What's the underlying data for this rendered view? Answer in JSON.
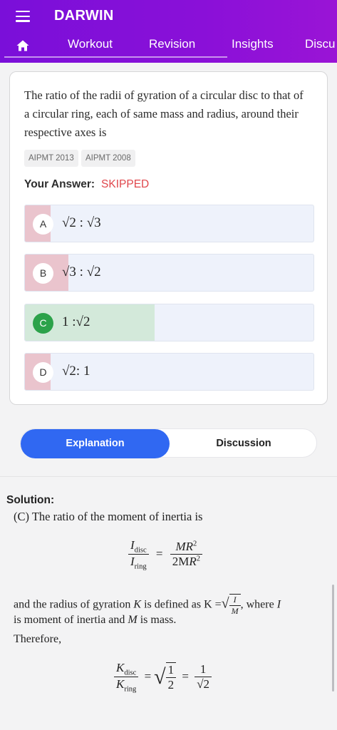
{
  "app": {
    "title": "DARWIN"
  },
  "tabs": [
    {
      "label": "Workout"
    },
    {
      "label": "Revision"
    },
    {
      "label": "Insights"
    },
    {
      "label": "Discu"
    }
  ],
  "question": {
    "text": "The ratio of the radii of gyration of a circular disc to that of a circular ring, each of same mass and radius, around their respective axes is",
    "tags": [
      "AIPMT 2013",
      "AIPMT 2008"
    ],
    "answer_label": "Your Answer:",
    "answer_value": "SKIPPED"
  },
  "options": [
    {
      "letter": "A",
      "text": "√2 : √3",
      "fill_fraction": 0.09,
      "fill_color": "#eac4cd"
    },
    {
      "letter": "B",
      "text": "√3 : √2",
      "fill_fraction": 0.15,
      "fill_color": "#eac4cd"
    },
    {
      "letter": "C",
      "text": "1 :√2",
      "fill_fraction": 0.45,
      "fill_color": "#d3e9da",
      "correct": true
    },
    {
      "letter": "D",
      "text": "√2: 1",
      "fill_fraction": 0.09,
      "fill_color": "#eac4cd"
    }
  ],
  "segments": {
    "active": "Explanation",
    "other": "Discussion"
  },
  "solution": {
    "title": "Solution:",
    "line1": "(C) The ratio of the moment of inertia is",
    "line2a": "and the radius of gyration",
    "line2b": "is defined as",
    "line2c": ", where",
    "line3": "is moment of inertia and",
    "line3b": "is mass.",
    "line4": "Therefore,"
  },
  "colors": {
    "appbar": "#8a10d8",
    "accent": "#3068f2",
    "skipped": "#e0474c",
    "correct": "#2ca24a"
  }
}
